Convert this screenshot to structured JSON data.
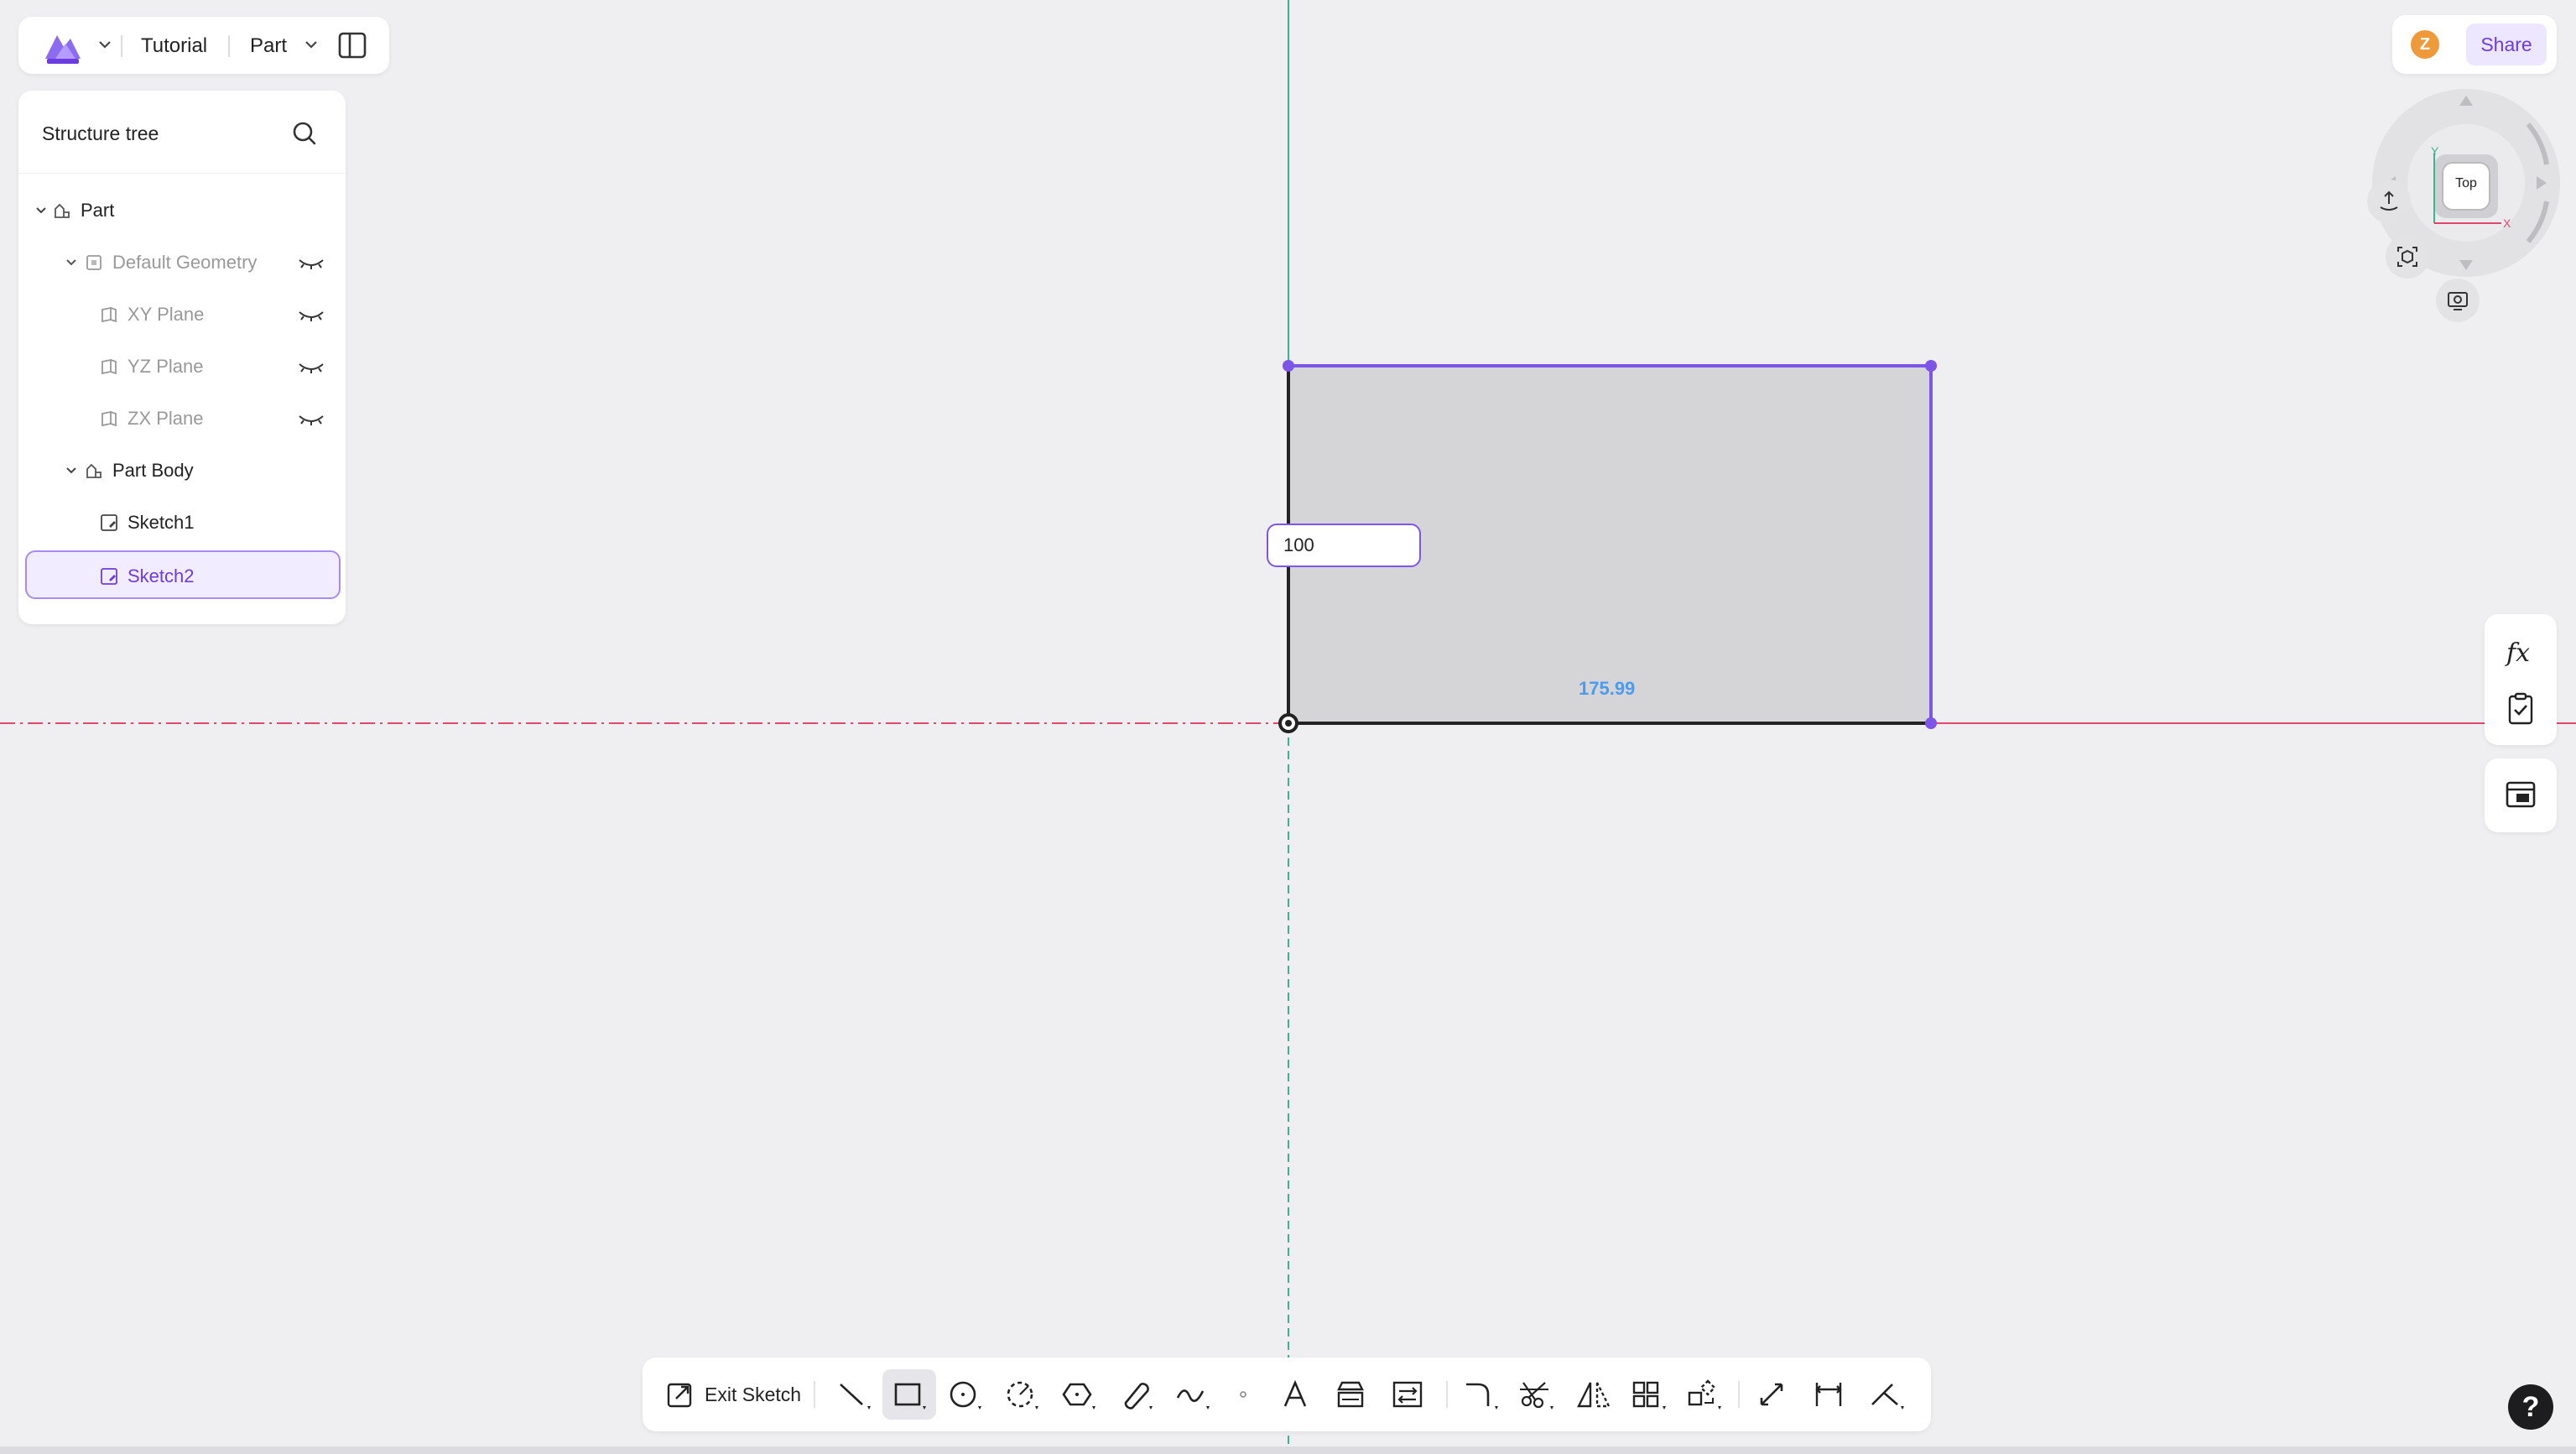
{
  "app": {
    "title": "Tutorial",
    "mode": "Part"
  },
  "tree": {
    "header": "Structure tree",
    "items": [
      {
        "label": "Part"
      },
      {
        "label": "Default Geometry"
      },
      {
        "label": "XY Plane"
      },
      {
        "label": "YZ Plane"
      },
      {
        "label": "ZX Plane"
      },
      {
        "label": "Part Body"
      },
      {
        "label": "Sketch1"
      },
      {
        "label": "Sketch2"
      }
    ]
  },
  "user": {
    "avatar_letter": "Z",
    "share_label": "Share"
  },
  "viewcube": {
    "face": "Top",
    "axis_y": "Y",
    "axis_x": "X"
  },
  "sketch": {
    "dimension_input_value": "100",
    "dimension_width": "175.99"
  },
  "toolbar": {
    "exit_label": "Exit Sketch"
  },
  "help": {
    "label": "?"
  },
  "colors": {
    "accent": "#6c3ce0",
    "sketch_edge": "#7d55e9",
    "axis_red": "#e0476a",
    "axis_green": "#3bb58c",
    "dimension_blue": "#4b9cf0"
  }
}
